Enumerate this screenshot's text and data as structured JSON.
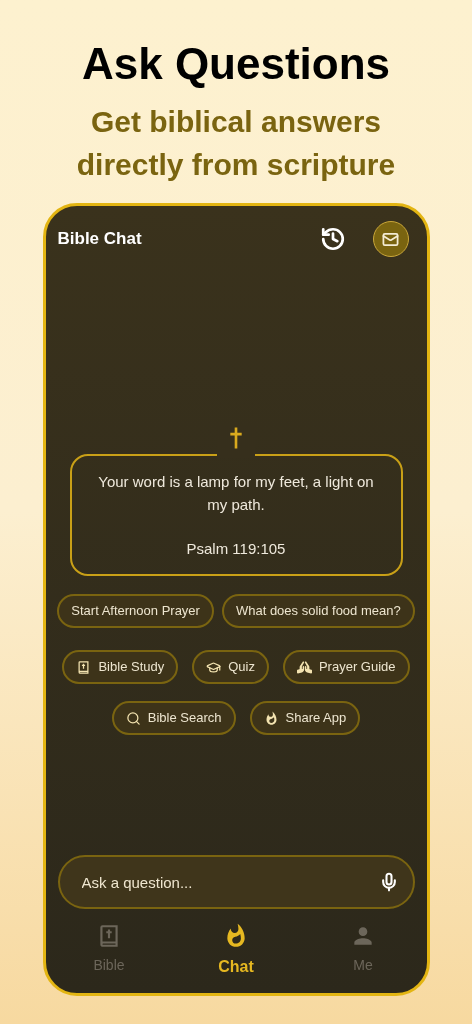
{
  "headline": "Ask Questions",
  "subheadline": "Get biblical answers directly from scripture",
  "app": {
    "title": "Bible Chat",
    "verse": {
      "text": "Your word is a lamp for my feet, a light on my path.",
      "reference": "Psalm 119:105"
    },
    "suggestions": [
      "Start Afternoon Prayer",
      "What does solid food mean?"
    ],
    "actions": [
      [
        {
          "label": "Bible Study",
          "kind": "bible"
        },
        {
          "label": "Quiz",
          "kind": "quiz"
        },
        {
          "label": "Prayer Guide",
          "kind": "prayer"
        }
      ],
      [
        {
          "label": "Bible Search",
          "kind": "search"
        },
        {
          "label": "Share App",
          "kind": "share"
        }
      ]
    ],
    "input": {
      "placeholder": "Ask a question..."
    },
    "nav": [
      {
        "label": "Bible",
        "kind": "bible",
        "selected": false
      },
      {
        "label": "Chat",
        "kind": "chat",
        "selected": true
      },
      {
        "label": "Me",
        "kind": "profile",
        "selected": false
      }
    ]
  }
}
